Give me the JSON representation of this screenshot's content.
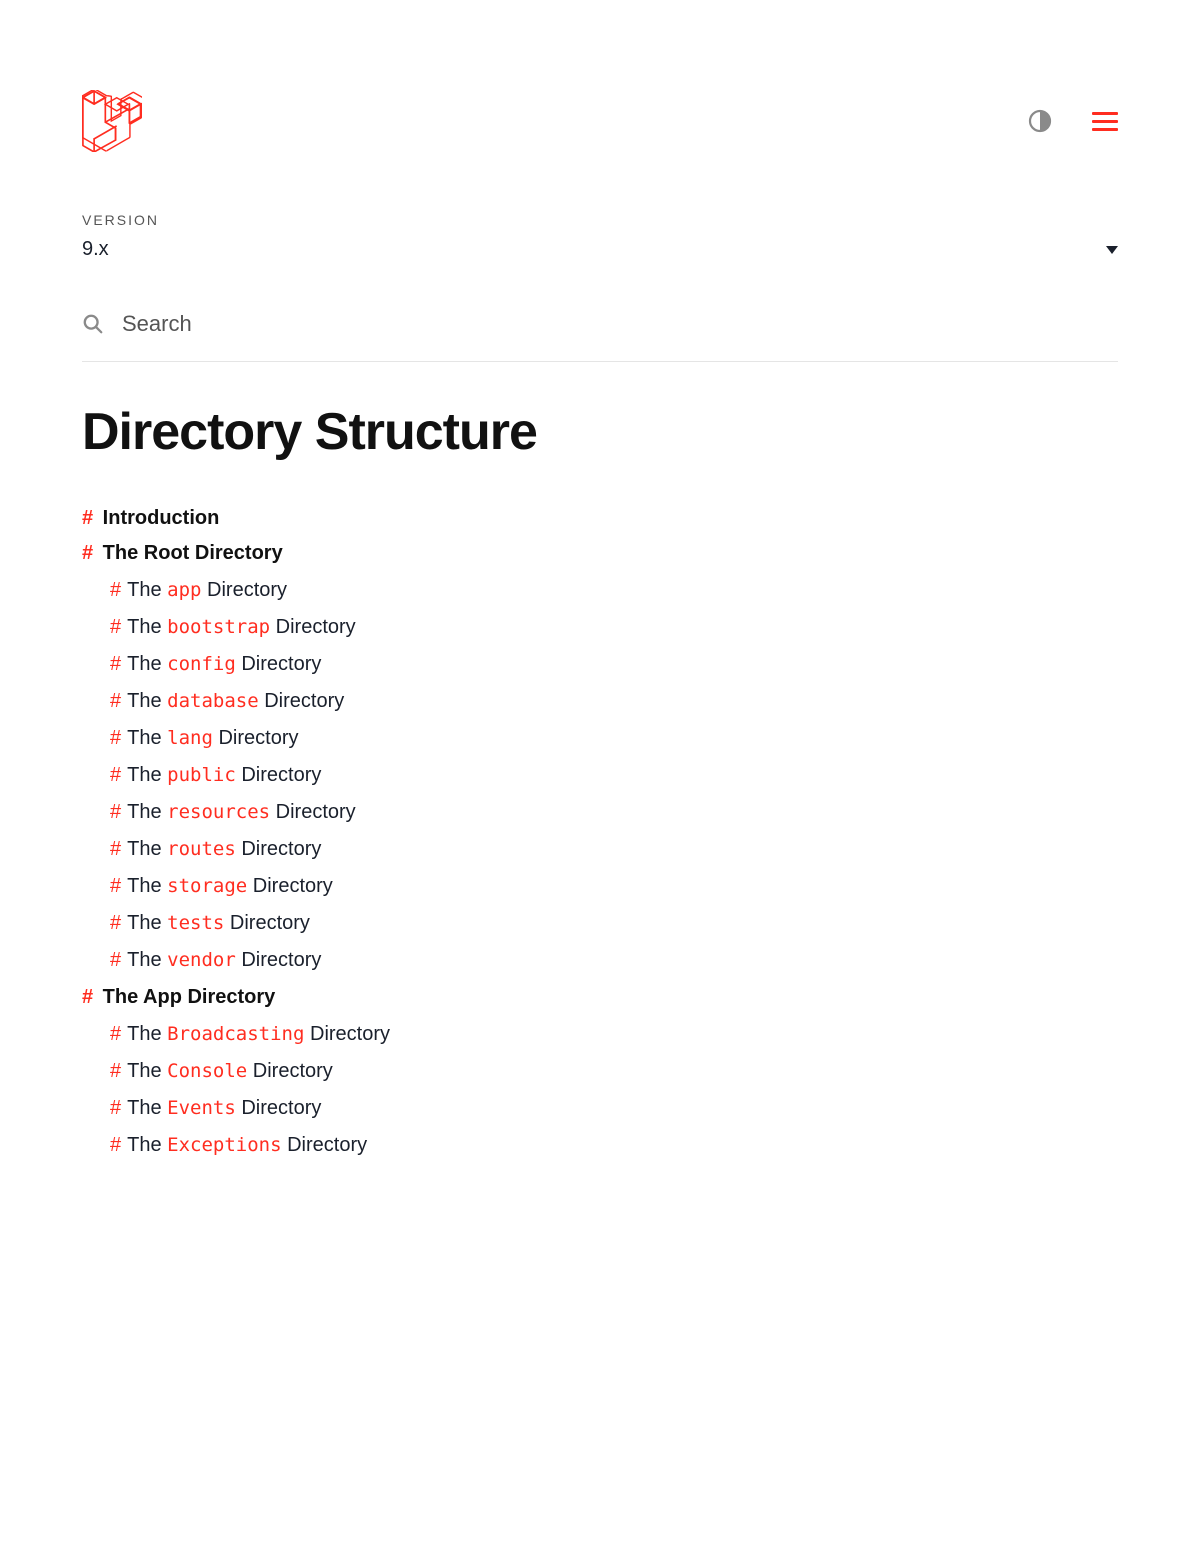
{
  "versionLabel": "VERSION",
  "versionValue": "9.x",
  "searchPlaceholder": "Search",
  "pageTitle": "Directory Structure",
  "toc": [
    {
      "label": "Introduction",
      "children": []
    },
    {
      "label": "The Root Directory",
      "children": [
        {
          "pre": "The ",
          "code": "app",
          "post": " Directory"
        },
        {
          "pre": "The ",
          "code": "bootstrap",
          "post": " Directory"
        },
        {
          "pre": "The ",
          "code": "config",
          "post": " Directory"
        },
        {
          "pre": "The ",
          "code": "database",
          "post": " Directory"
        },
        {
          "pre": "The ",
          "code": "lang",
          "post": " Directory"
        },
        {
          "pre": "The ",
          "code": "public",
          "post": " Directory"
        },
        {
          "pre": "The ",
          "code": "resources",
          "post": " Directory"
        },
        {
          "pre": "The ",
          "code": "routes",
          "post": " Directory"
        },
        {
          "pre": "The ",
          "code": "storage",
          "post": " Directory"
        },
        {
          "pre": "The ",
          "code": "tests",
          "post": " Directory"
        },
        {
          "pre": "The ",
          "code": "vendor",
          "post": " Directory"
        }
      ]
    },
    {
      "label": "The App Directory",
      "children": [
        {
          "pre": "The ",
          "code": "Broadcasting",
          "post": " Directory"
        },
        {
          "pre": "The ",
          "code": "Console",
          "post": " Directory"
        },
        {
          "pre": "The ",
          "code": "Events",
          "post": " Directory"
        },
        {
          "pre": "The ",
          "code": "Exceptions",
          "post": " Directory"
        }
      ]
    }
  ]
}
